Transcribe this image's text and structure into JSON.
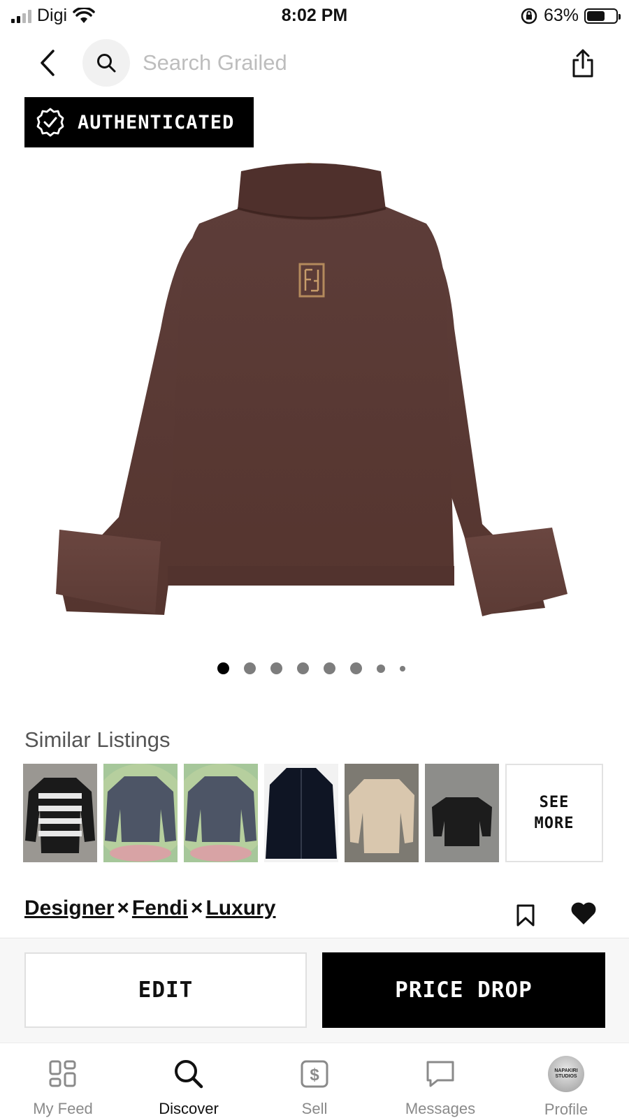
{
  "status_bar": {
    "carrier": "Digi",
    "time": "8:02 PM",
    "battery": "63%",
    "battery_level": 0.63,
    "icons": [
      "signal-icon",
      "wifi-icon",
      "orientation-lock-icon",
      "battery-icon"
    ]
  },
  "top_nav": {
    "search_placeholder": "Search Grailed",
    "icons": [
      "back-icon",
      "search-icon",
      "share-icon"
    ]
  },
  "badge": {
    "label": "AUTHENTICATED",
    "icon": "verified-check-icon"
  },
  "product": {
    "image_description_icon": "product-photo",
    "carousel_count": 8,
    "carousel_active": 0
  },
  "similar": {
    "title": "Similar Listings",
    "see_more": "SEE MORE"
  },
  "designers": {
    "items": [
      "Designer",
      "Fendi",
      "Luxury"
    ],
    "separator": "×",
    "icons": [
      "bookmark-icon",
      "heart-icon"
    ]
  },
  "actions": {
    "edit": "EDIT",
    "price_drop": "PRICE DROP"
  },
  "tabs": [
    {
      "label": "My Feed",
      "icon": "feed-grid-icon"
    },
    {
      "label": "Discover",
      "icon": "search-icon",
      "active": true
    },
    {
      "label": "Sell",
      "icon": "dollar-tag-icon"
    },
    {
      "label": "Messages",
      "icon": "chat-bubble-icon"
    },
    {
      "label": "Profile",
      "icon": "avatar",
      "avatar_text": "NAPAKIRI STUDIOS"
    }
  ],
  "colors": {
    "brand_black": "#000000",
    "sweater_brown": "#5a3a36"
  }
}
